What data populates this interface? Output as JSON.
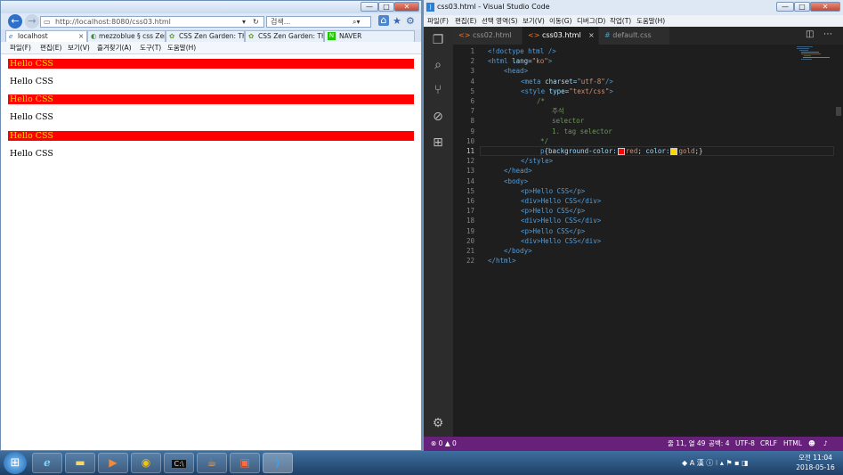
{
  "ie": {
    "window_controls": [
      "—",
      "□",
      "✕"
    ],
    "address": "http://localhost:8080/css03.html",
    "search_placeholder": "검색...",
    "tabs": [
      {
        "label": "localhost"
      },
      {
        "label": "mezzoblue § css Zen..."
      },
      {
        "label": "CSS Zen Garden: The..."
      },
      {
        "label": "CSS Zen Garden: The..."
      },
      {
        "label": "NAVER"
      }
    ],
    "menu": [
      "파일(F)",
      "편집(E)",
      "보기(V)",
      "즐겨찾기(A)",
      "도구(T)",
      "도움말(H)"
    ],
    "paragraphs": [
      {
        "text": "Hello CSS",
        "style": "red"
      },
      {
        "text": "Hello CSS",
        "style": "plain"
      },
      {
        "text": "Hello CSS",
        "style": "red"
      },
      {
        "text": "Hello CSS",
        "style": "plain"
      },
      {
        "text": "Hello CSS",
        "style": "red"
      },
      {
        "text": "Hello CSS",
        "style": "plain"
      }
    ]
  },
  "vscode": {
    "title": "css03.html - Visual Studio Code",
    "menu": [
      "파일(F)",
      "편집(E)",
      "선택 영역(S)",
      "보기(V)",
      "이동(G)",
      "디버그(D)",
      "작업(T)",
      "도움말(H)"
    ],
    "tabs": [
      {
        "label": "css02.html",
        "icon": "<>"
      },
      {
        "label": "css03.html",
        "icon": "<>"
      },
      {
        "label": "default.css",
        "icon": "#"
      }
    ],
    "code_lines": [
      "1",
      "2",
      "3",
      "4",
      "5",
      "6",
      "7",
      "8",
      "9",
      "10",
      "11",
      "12",
      "13",
      "14",
      "15",
      "16",
      "17",
      "18",
      "19",
      "20",
      "21",
      "22"
    ],
    "code": {
      "l1": "<!doctype html />",
      "l2a": "<html",
      "l2b": " lang=",
      "l2c": "\"ko\"",
      "l2d": ">",
      "l3": "<head>",
      "l4a": "<meta",
      "l4b": " charset=",
      "l4c": "\"utf-8\"",
      "l4d": "/>",
      "l5a": "<style",
      "l5b": " type=",
      "l5c": "\"text/css\"",
      "l5d": ">",
      "l6": "/*",
      "l7": "주석",
      "l8": "selector",
      "l9": "1. tag selector",
      "l10": "*/",
      "l11a": "p",
      "l11b": "{",
      "l11c": "background-color:",
      "l11d": "red",
      "l11e": "; ",
      "l11f": "color:",
      "l11g": "gold",
      "l11h": ";}",
      "l12": "</style>",
      "l13": "</head>",
      "l14": "<body>",
      "l15": "<p>Hello CSS</p>",
      "l16": "<div>Hello CSS</div>",
      "l17": "<p>Hello CSS</p>",
      "l18": "<div>Hello CSS</div>",
      "l19": "<p>Hello CSS</p>",
      "l20": "<div>Hello CSS</div>",
      "l21": "</body>",
      "l22": "</html>"
    },
    "status": {
      "problems": "⊗ 0 ▲ 0",
      "position": "줄 11, 열 49",
      "spaces": "공백: 4",
      "encoding": "UTF-8",
      "eol": "CRLF",
      "language": "HTML"
    }
  },
  "taskbar": {
    "time": "오전 11:04",
    "date": "2018-05-16"
  },
  "colors": {
    "red": "#ff0000",
    "gold": "#ffd700",
    "vscode_status": "#68217a"
  }
}
